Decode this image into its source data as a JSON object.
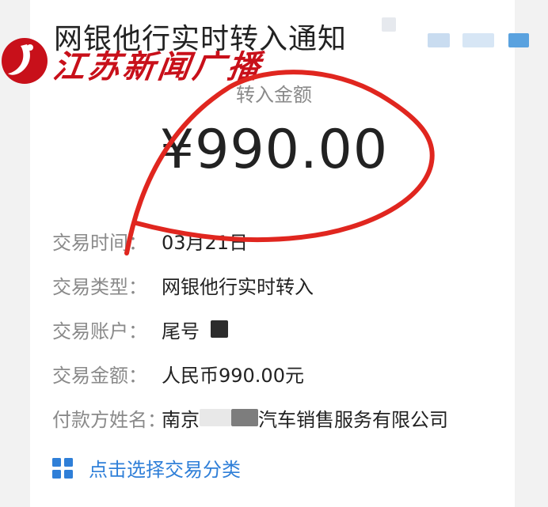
{
  "header": {
    "title": "网银他行实时转入通知"
  },
  "watermark": {
    "text": "江苏新闻广播",
    "color": "#c8101a"
  },
  "amount": {
    "label": "转入金额",
    "value": "¥990.00"
  },
  "details": [
    {
      "label": "交易时间：",
      "value": "03月21日"
    },
    {
      "label": "交易类型：",
      "value": "网银他行实时转入"
    },
    {
      "label": "交易账户：",
      "value": "尾号"
    },
    {
      "label": "交易金额：",
      "value": "人民币990.00元"
    },
    {
      "label": "付款方姓名：",
      "value_prefix": "南京",
      "value_suffix": "汽车销售服务有限公司"
    }
  ],
  "category": {
    "label": "点击选择交易分类",
    "icon": "grid-icon",
    "color": "#2f7fd8"
  },
  "annotation": {
    "color": "#e0261f"
  }
}
